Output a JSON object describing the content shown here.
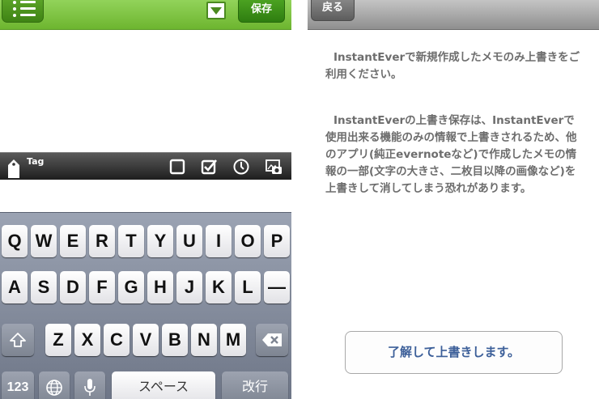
{
  "editor": {
    "header": {
      "save_label": "保存"
    },
    "toolbar": {
      "tag_label": "Tag"
    },
    "keyboard": {
      "row1": [
        "Q",
        "W",
        "E",
        "R",
        "T",
        "Y",
        "U",
        "I",
        "O",
        "P"
      ],
      "row2": [
        "A",
        "S",
        "D",
        "F",
        "G",
        "H",
        "J",
        "K",
        "L",
        "—"
      ],
      "row3": [
        "Z",
        "X",
        "C",
        "V",
        "B",
        "N",
        "M"
      ],
      "numbers_key": "123",
      "space_key": "スペース",
      "return_key": "改行"
    },
    "colors": {
      "accent_green": "#6db52f",
      "save_green": "#2e7d10"
    }
  },
  "dialog": {
    "back_label": "戻る",
    "message_1": "InstantEverで新規作成したメモのみ上書きをご利用ください。",
    "message_2": "InstantEverの上書き保存は、InstantEverで使用出来る機能のみの情報で上書きされるため、他のアプリ(純正evernoteなど)で作成したメモの情報の一部(文字の大きさ、二枚目以降の画像など)を上書きして消してしまう恐れがあります。",
    "confirm_label": "了解して上書きします。",
    "colors": {
      "text_gray": "#6d6d6d",
      "button_text_blue": "#3c5f99"
    }
  }
}
